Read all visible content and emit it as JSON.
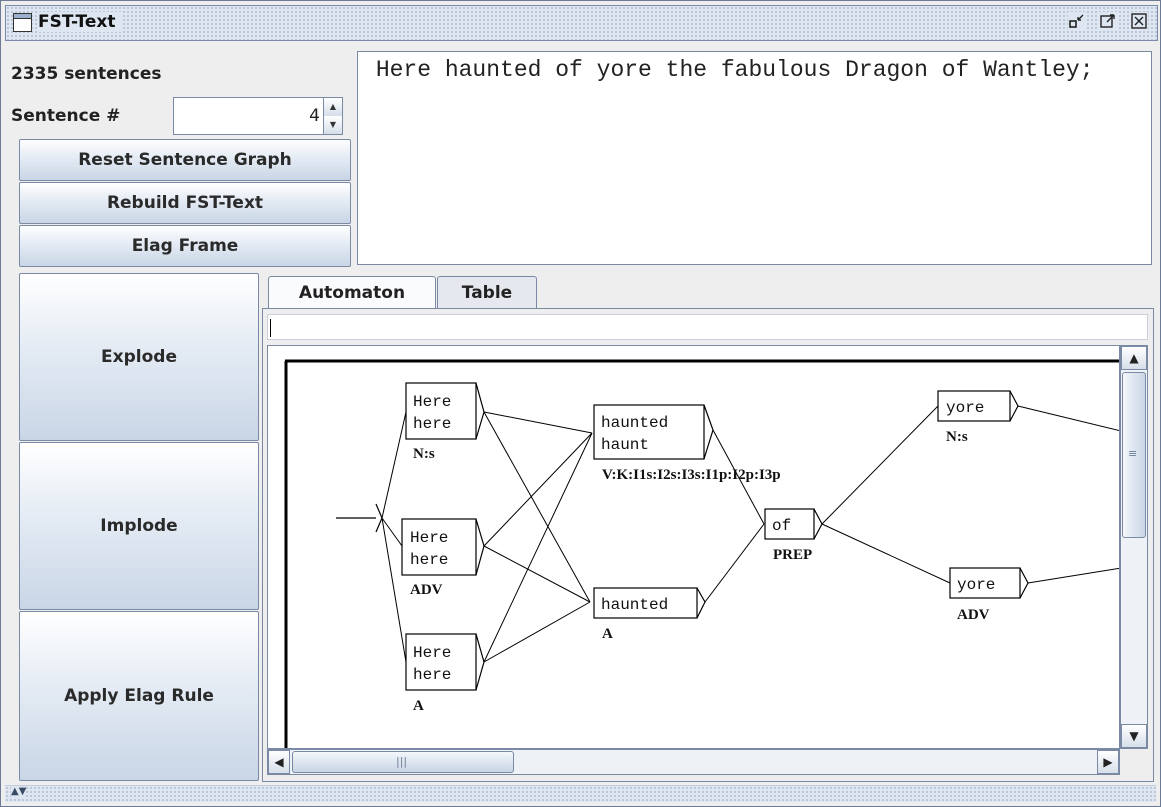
{
  "window": {
    "title": "FST-Text",
    "controls": [
      "minimize-icon",
      "maximize-icon",
      "close-icon"
    ]
  },
  "controls": {
    "sentence_count": "2335 sentences",
    "sentence_label": "Sentence #",
    "sentence_number": "4",
    "reset_label": "Reset Sentence Graph",
    "rebuild_label": "Rebuild FST-Text",
    "elag_frame_label": "Elag Frame"
  },
  "sentence_text": " Here haunted of yore the fabulous Dragon of Wantley;",
  "actions": {
    "explode": "Explode",
    "implode": "Implode",
    "apply_elag": "Apply Elag Rule"
  },
  "tabs": [
    {
      "label": "Automaton",
      "active": true
    },
    {
      "label": "Table",
      "active": false
    }
  ],
  "automaton_input": "",
  "graph": {
    "boxes": [
      {
        "lines": [
          "Here",
          "here"
        ],
        "tag": "N:s"
      },
      {
        "lines": [
          "Here",
          "here"
        ],
        "tag": "ADV"
      },
      {
        "lines": [
          "Here",
          "here"
        ],
        "tag": "A"
      },
      {
        "lines": [
          "haunted",
          "haunt"
        ],
        "tag": "V:K:I1s:I2s:I3s:I1p:I2p:I3p"
      },
      {
        "lines": [
          "haunted"
        ],
        "tag": "A"
      },
      {
        "lines": [
          "of"
        ],
        "tag": "PREP"
      },
      {
        "lines": [
          "yore"
        ],
        "tag": "N:s"
      },
      {
        "lines": [
          "yore"
        ],
        "tag": "ADV"
      }
    ]
  },
  "colors": {
    "button_top": "#ffffff",
    "button_bottom": "#c9d6e6",
    "border": "#7a8aa5",
    "titlebar": "#dde6f1"
  }
}
